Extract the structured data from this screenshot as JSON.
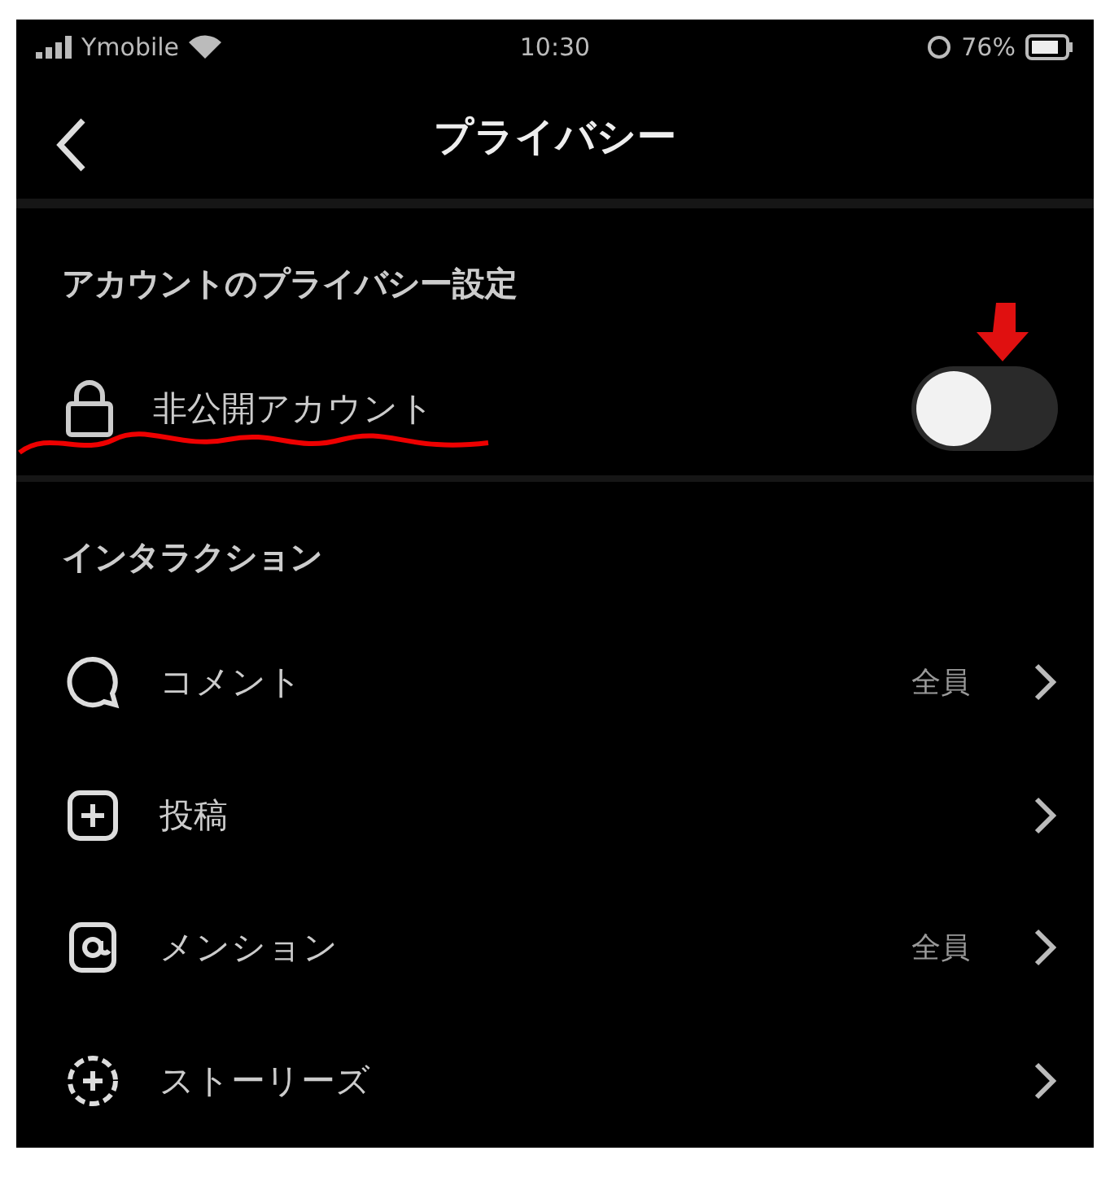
{
  "status_bar": {
    "carrier": "Ymobile",
    "time": "10:30",
    "battery": "76%"
  },
  "header": {
    "title": "プライバシー"
  },
  "account_section": {
    "title": "アカウントのプライバシー設定",
    "private_account": {
      "label": "非公開アカウント",
      "on": false
    }
  },
  "interaction_section": {
    "title": "インタラクション",
    "items": [
      {
        "kind": "comment",
        "label": "コメント",
        "value": "全員"
      },
      {
        "kind": "post",
        "label": "投稿"
      },
      {
        "kind": "mention",
        "label": "メンション",
        "value": "全員"
      },
      {
        "kind": "story",
        "label": "ストーリーズ"
      }
    ]
  }
}
